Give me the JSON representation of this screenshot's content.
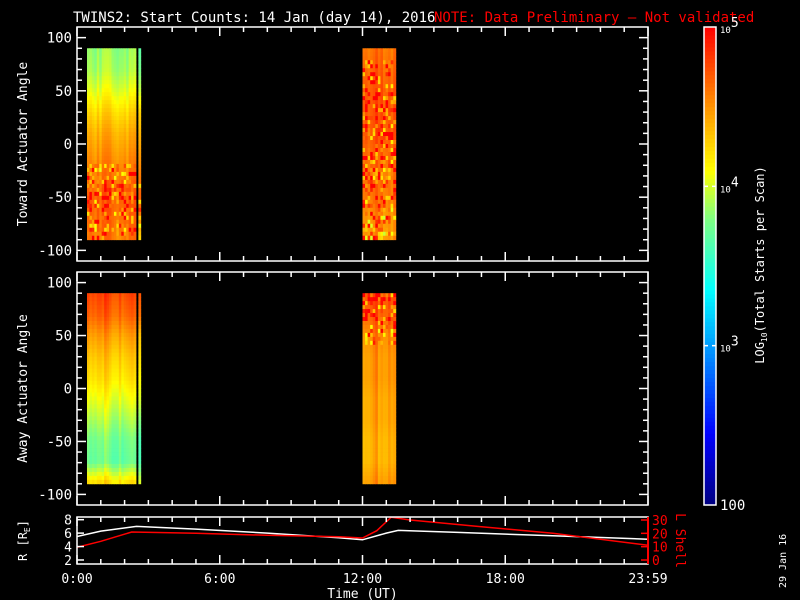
{
  "title": "TWINS2: Start Counts: 14 Jan (day  14), 2016",
  "note": "NOTE: Data Preliminary – Not validated",
  "date_stamp": "29 Jan 16",
  "colors": {
    "note": "#ff0000",
    "axis": "#ffffff",
    "lshell": "#ff0000",
    "radius": "#ffffff"
  },
  "chart_data": [
    {
      "type": "heatmap",
      "name": "toward",
      "ylabel": "Toward Actuator Angle",
      "ylim": [
        -110,
        110
      ],
      "yticks": [
        "100",
        "50",
        "0",
        "-50",
        "-100"
      ],
      "ytick_values": [
        100,
        50,
        0,
        -50,
        -100
      ],
      "xlim_hours": [
        0,
        24
      ],
      "angle_range": [
        90,
        -90
      ],
      "blocks": [
        {
          "t0": 0.42,
          "t1": 2.48,
          "profile": [
            3.85,
            3.9,
            4.05,
            4.25,
            4.4,
            4.5,
            4.6,
            4.7,
            4.65,
            4.6
          ],
          "noise_from": 0.6
        },
        {
          "t0": 2.58,
          "t1": 2.68,
          "profile": [
            3.6,
            3.7,
            3.9,
            4.2,
            4.3,
            4.4,
            4.5,
            4.6,
            4.5,
            4.2
          ],
          "noise_from": 0.7
        },
        {
          "t0": 12.0,
          "t1": 13.4,
          "profile": [
            4.6,
            4.65,
            4.7,
            4.7,
            4.7,
            4.65,
            4.6,
            4.6,
            4.5,
            4.5
          ],
          "noise_from": 0.05
        }
      ]
    },
    {
      "type": "heatmap",
      "name": "away",
      "ylabel": "Away Actuator Angle",
      "ylim": [
        -110,
        110
      ],
      "yticks": [
        "100",
        "50",
        "0",
        "-50",
        "-100"
      ],
      "ytick_values": [
        100,
        50,
        0,
        -50,
        -100
      ],
      "xlim_hours": [
        0,
        24
      ],
      "angle_range": [
        90,
        -90
      ],
      "blocks": [
        {
          "t0": 0.42,
          "t1": 2.48,
          "profile": [
            4.75,
            4.65,
            4.45,
            4.3,
            4.2,
            4.05,
            3.9,
            3.75,
            3.7,
            4.2
          ],
          "noise_from": -1
        },
        {
          "t0": 2.58,
          "t1": 2.68,
          "profile": [
            4.7,
            4.6,
            4.3,
            4.2,
            4.1,
            4.0,
            3.8,
            3.6,
            3.6,
            4.0
          ],
          "noise_from": -1
        },
        {
          "t0": 12.0,
          "t1": 13.4,
          "profile": [
            4.75,
            4.7,
            4.55,
            4.5,
            4.5,
            4.45,
            4.45,
            4.4,
            4.4,
            4.5
          ],
          "noise_from": 0.0,
          "noise_to": 0.25
        }
      ]
    },
    {
      "type": "line",
      "name": "orbit",
      "ylabel": "R [R",
      "ylabel_sub": "E",
      "ylabel_end": "]",
      "y2label": "L Shell",
      "ylim": [
        1.4,
        8.4
      ],
      "y2lim": [
        0,
        30
      ],
      "yticks": [
        "8",
        "6",
        "4",
        "2"
      ],
      "ytick_values": [
        8,
        6,
        4,
        2
      ],
      "y2ticks": [
        "30",
        "20",
        "10",
        "0"
      ],
      "y2tick_values": [
        30,
        20,
        10,
        0
      ],
      "xlabel": "Time (UT)",
      "xticks": [
        "0:00",
        "6:00",
        "12:00",
        "18:00",
        "23:59"
      ],
      "xtick_values": [
        0,
        6,
        12,
        18,
        24
      ],
      "series": [
        {
          "name": "R",
          "axis": "left",
          "x": [
            0,
            1,
            2.5,
            5,
            8,
            11,
            12,
            13,
            13.5,
            16,
            20,
            24
          ],
          "y": [
            5.5,
            6.3,
            7.0,
            6.6,
            6.0,
            5.3,
            5.0,
            6.0,
            6.4,
            6.1,
            5.6,
            5.1
          ]
        },
        {
          "name": "L Shell",
          "axis": "right",
          "x": [
            0,
            1,
            2.3,
            5,
            8,
            11,
            12,
            12.6,
            13.2,
            14,
            17,
            20,
            24
          ],
          "y": [
            9.5,
            14,
            21,
            20,
            18.5,
            17.5,
            16.5,
            22,
            32,
            30,
            25,
            20,
            11
          ]
        }
      ]
    }
  ],
  "colorbar": {
    "label_main": "LOG",
    "label_sub": "10",
    "label_end": "(Total Starts per Scan)",
    "range_log": [
      2,
      5
    ],
    "ticks": [
      {
        "base": "10",
        "exp": "5",
        "value": 5
      },
      {
        "base": "10",
        "exp": "4",
        "value": 4
      },
      {
        "base": "10",
        "exp": "3",
        "value": 3
      },
      {
        "base": "100",
        "exp": "",
        "value": 2
      }
    ]
  }
}
